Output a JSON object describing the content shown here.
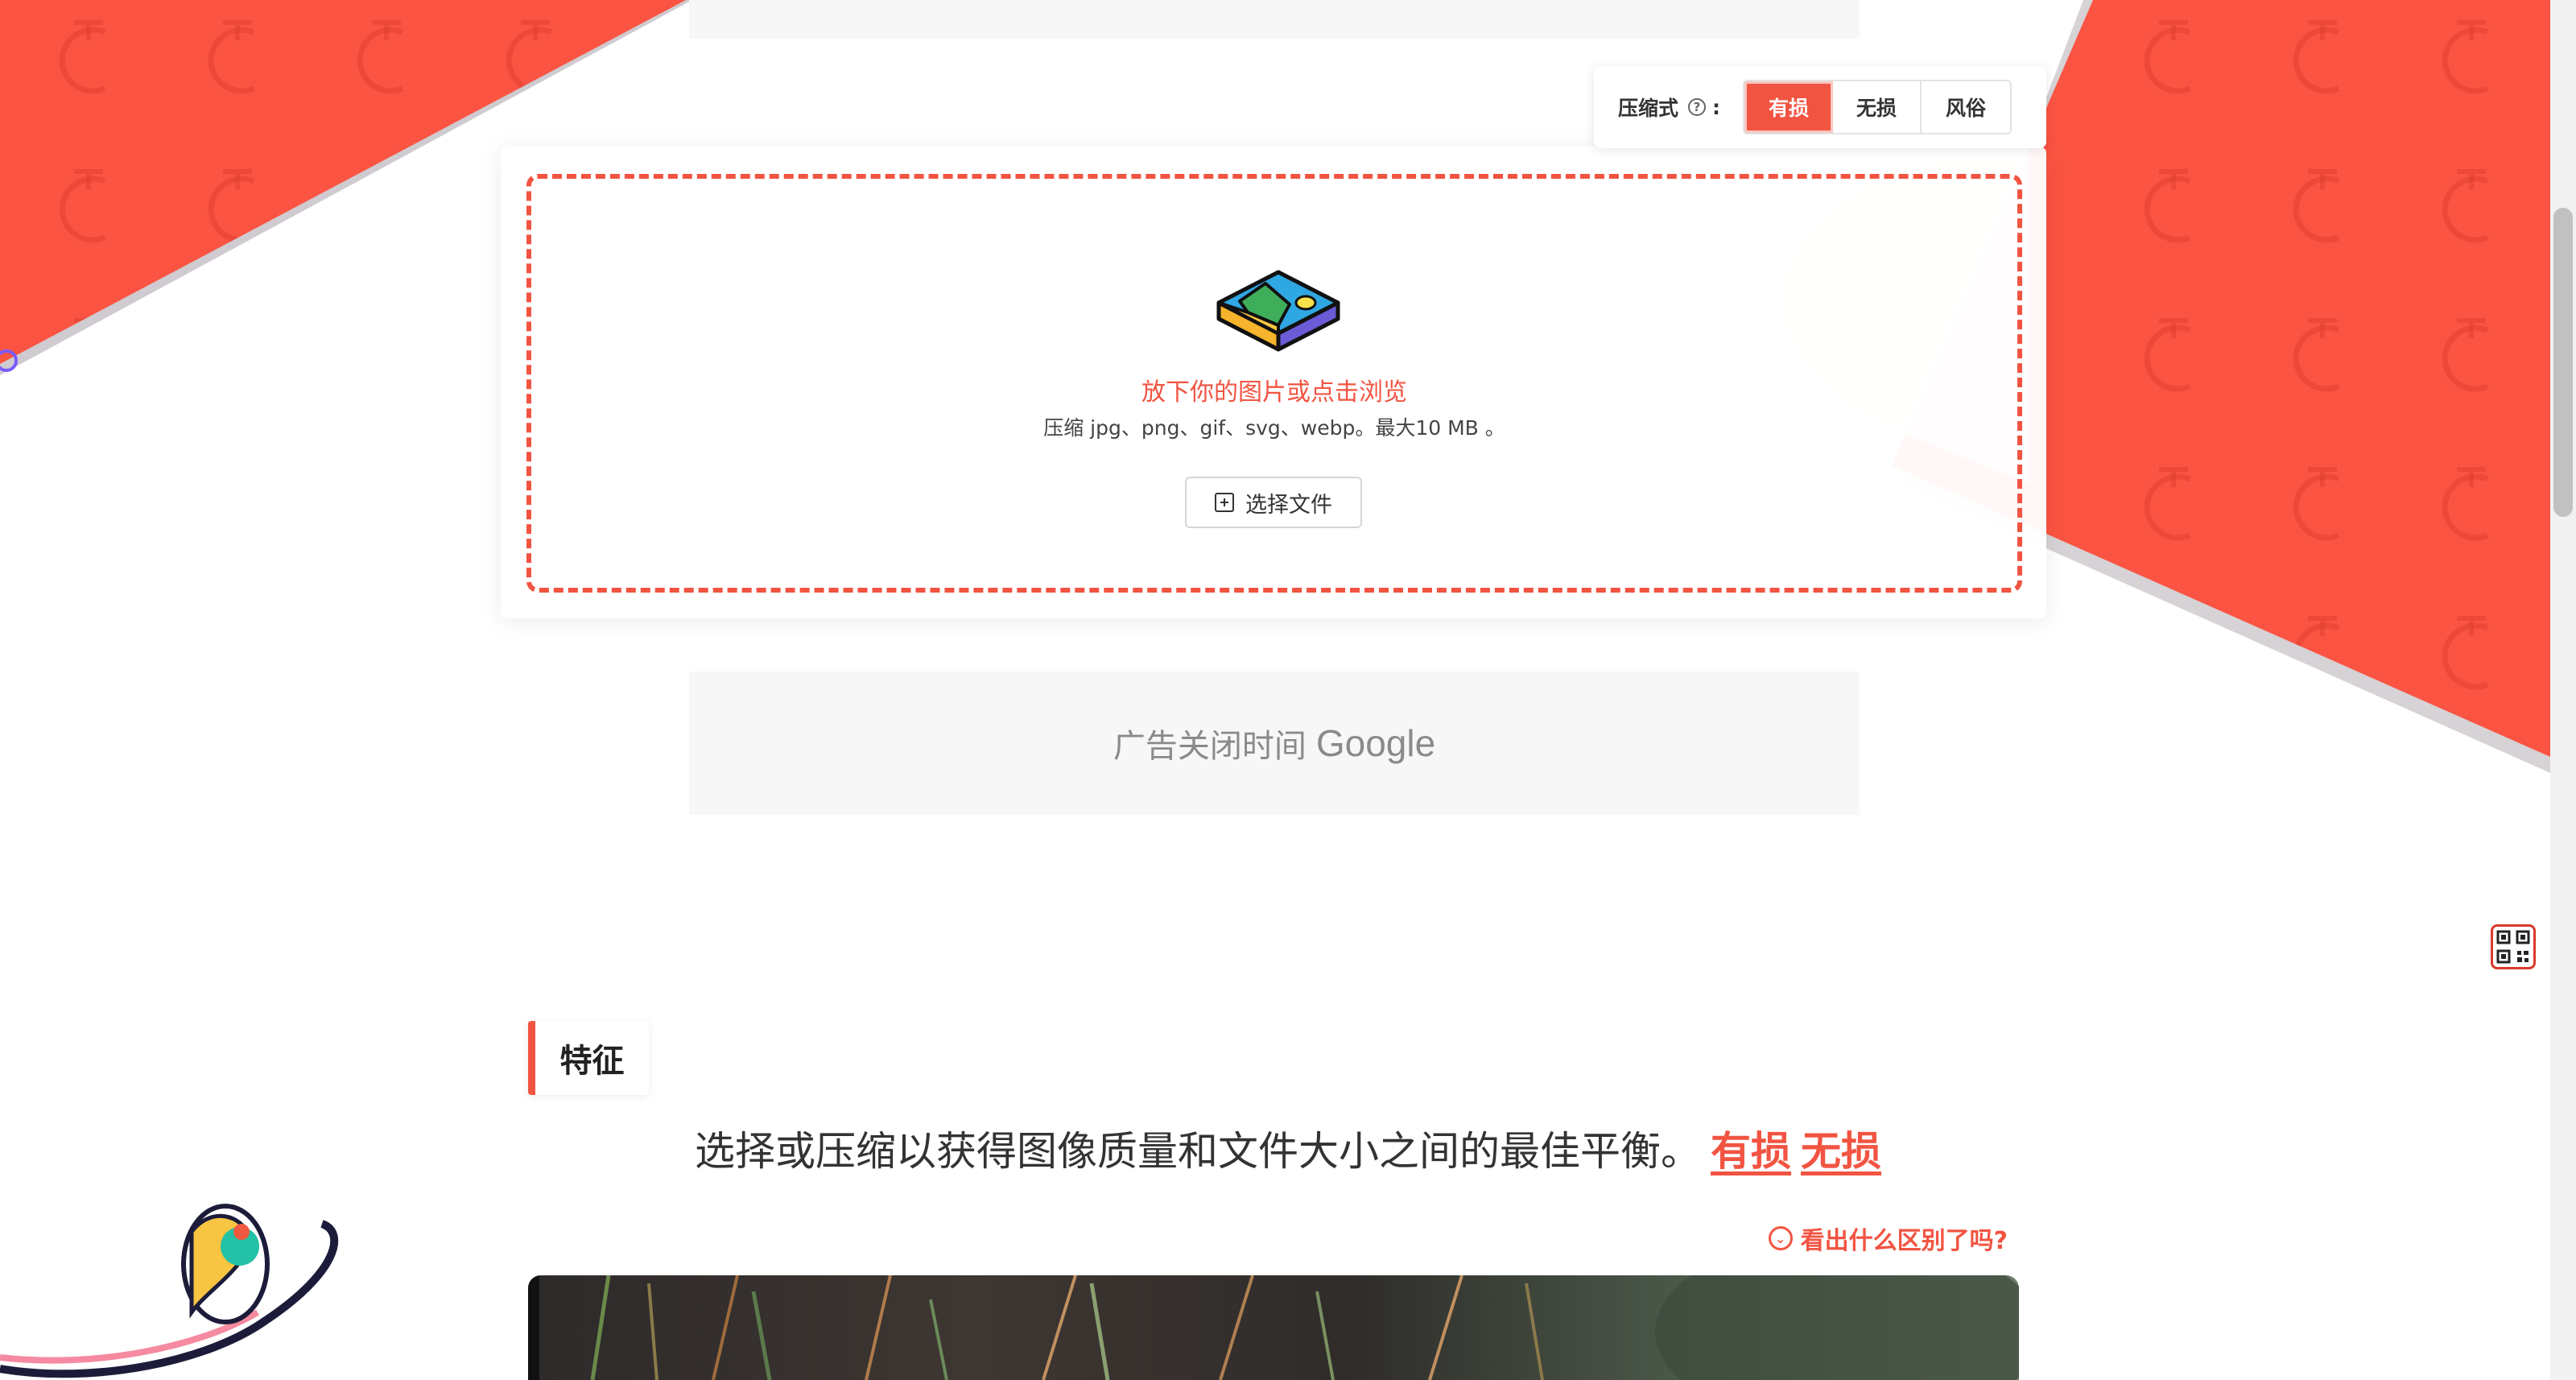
{
  "compression": {
    "label": "压缩式",
    "help_icon": "question-circle-icon",
    "colon": ":",
    "modes": [
      {
        "label": "有损",
        "active": true
      },
      {
        "label": "无损",
        "active": false
      },
      {
        "label": "风俗",
        "active": false
      }
    ]
  },
  "upload": {
    "illustration": "image-file-icon",
    "title": "放下你的图片或点击浏览",
    "subtitle": "压缩 jpg、png、gif、svg、webp。最大10 MB 。",
    "button_icon": "plus-square-icon",
    "button_label": "选择文件"
  },
  "ad": {
    "text": "广告关闭时间",
    "brand": "Google"
  },
  "side": {
    "qr_icon": "qr-code-icon"
  },
  "features": {
    "heading": "特征",
    "description": "选择或压缩以获得图像质量和文件大小之间的最佳平衡。",
    "link_lossy": "有损",
    "link_lossless": "无损",
    "diff_icon": "chevron-down-circle-icon",
    "diff_link": "看出什么区别了吗?"
  },
  "colors": {
    "accent": "#f25442",
    "background_red": "#fb5442",
    "panel_background": "#f7f7f7"
  }
}
